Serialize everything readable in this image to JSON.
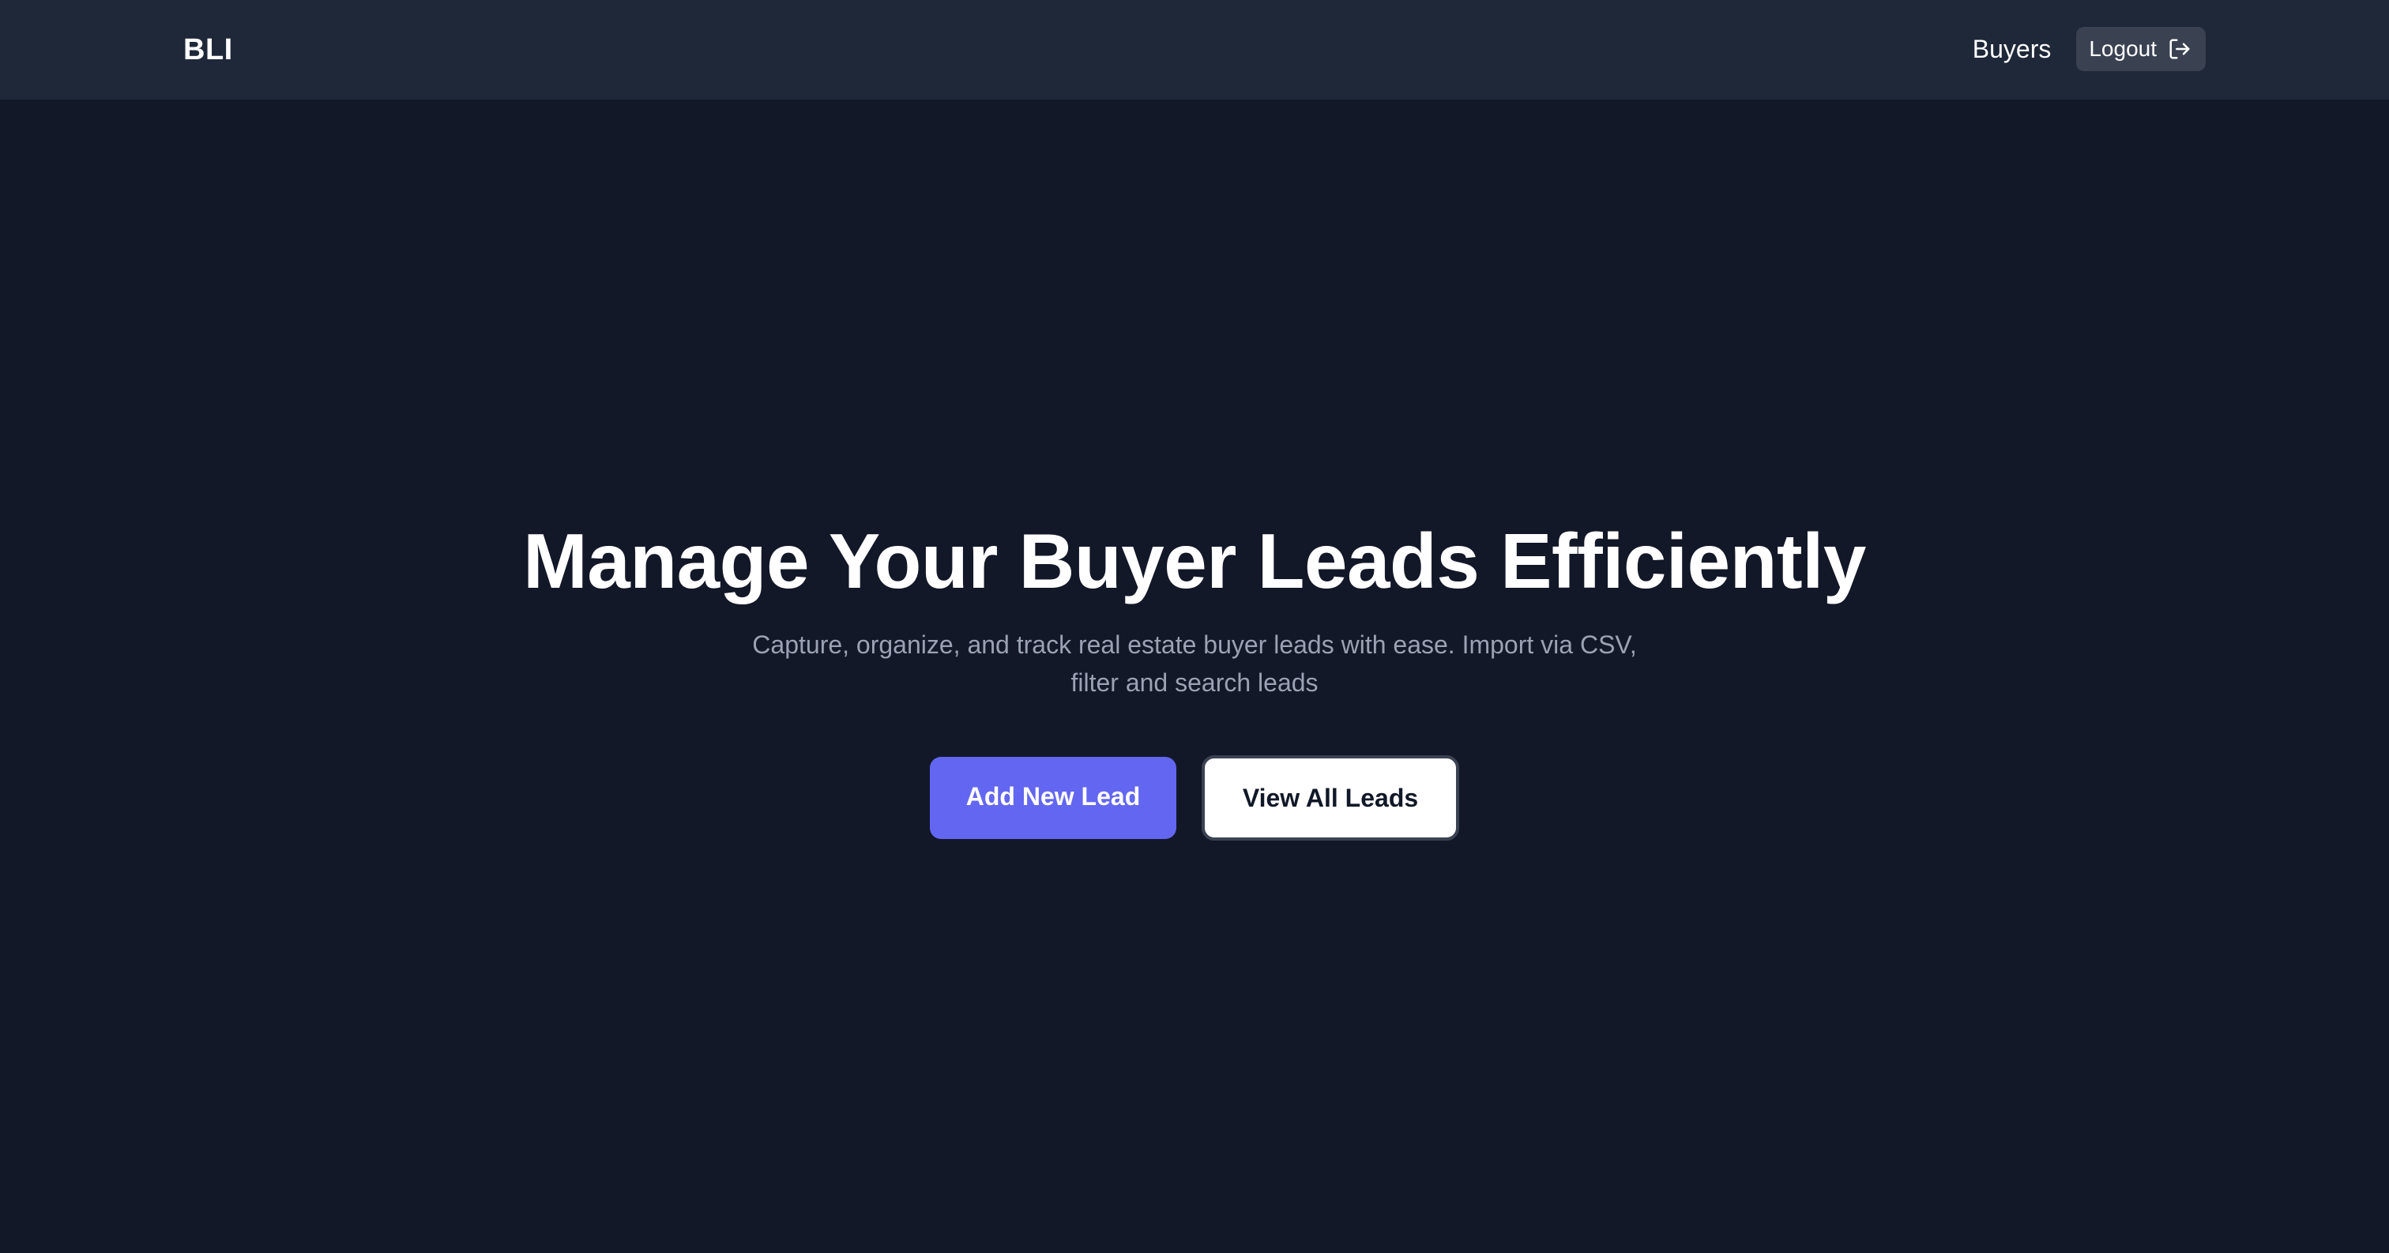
{
  "navbar": {
    "brand": "BLI",
    "links": {
      "buyers": "Buyers"
    },
    "logout": {
      "label": "Logout",
      "icon": "logout-icon"
    }
  },
  "hero": {
    "title": "Manage Your Buyer Leads Efficiently",
    "subtitle": "Capture, organize, and track real estate buyer leads with ease. Import via CSV, filter and search leads",
    "primary_button": "Add New Lead",
    "secondary_button": "View All Leads"
  },
  "colors": {
    "background": "#131828",
    "navbar": "#1f2838",
    "accent": "#6366f1",
    "muted_text": "#9aa2b3"
  }
}
